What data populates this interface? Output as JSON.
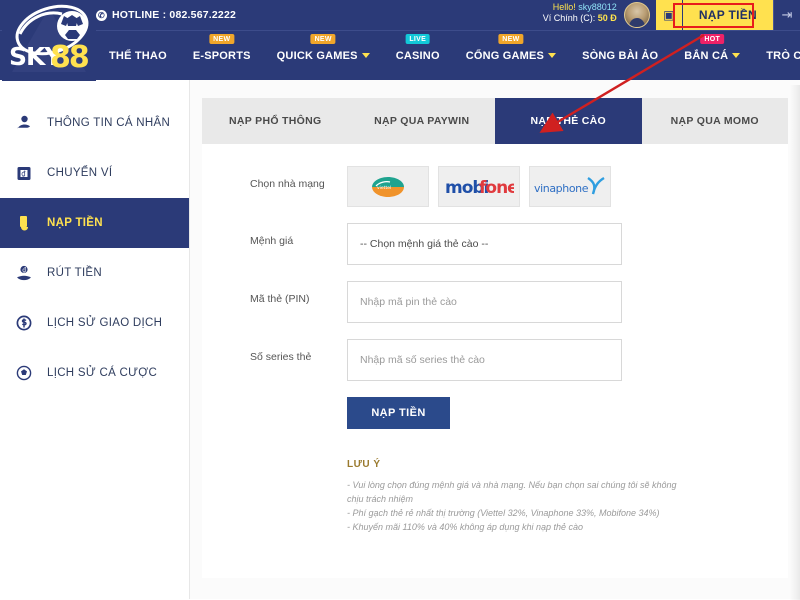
{
  "header": {
    "hotline_icon": "phone-icon",
    "hotline_label": "HOTLINE : 082.567.2222",
    "hello_prefix": "Hello! ",
    "username": "sky88012",
    "wallet_label": "Ví Chính (C): ",
    "wallet_amount": "50 Đ",
    "avatar_name": "avatar",
    "wallet_button_icon": "wallet-icon",
    "deposit_button_label": "NẠP TIỀN",
    "logout_icon": "logout-icon",
    "logo_text_sky": "SKY",
    "logo_text_88": "88",
    "accent_yellow": "#ffe14f",
    "brand_navy": "#2b3a78",
    "highlight_red": "#e81c1c"
  },
  "nav": {
    "items": [
      {
        "label": "THỂ THAO",
        "badge": "",
        "caret": false
      },
      {
        "label": "E-SPORTS",
        "badge": "NEW",
        "badge_type": "new",
        "caret": false
      },
      {
        "label": "QUICK GAMES",
        "badge": "NEW",
        "badge_type": "new",
        "caret": true
      },
      {
        "label": "CASINO",
        "badge": "LIVE",
        "badge_type": "live",
        "caret": false
      },
      {
        "label": "CỔNG GAMES",
        "badge": "NEW",
        "badge_type": "new",
        "caret": true
      },
      {
        "label": "SÒNG BÀI ẢO",
        "badge": "",
        "caret": false
      },
      {
        "label": "BẮN CÁ",
        "badge": "HOT",
        "badge_type": "hot",
        "caret": true
      },
      {
        "label": "TRÒ CHƠI ẢO",
        "badge": "",
        "caret": false
      }
    ]
  },
  "sidebar": {
    "items": [
      {
        "label": "THÔNG TIN CÁ NHÂN",
        "icon": "user-icon",
        "active": false
      },
      {
        "label": "CHUYỂN VÍ",
        "icon": "wallet-transfer-icon",
        "active": false
      },
      {
        "label": "NẠP TIỀN",
        "icon": "deposit-hand-icon",
        "active": true
      },
      {
        "label": "RÚT TIỀN",
        "icon": "withdraw-hand-icon",
        "active": false
      },
      {
        "label": "LỊCH SỬ GIAO DỊCH",
        "icon": "transaction-history-icon",
        "active": false
      },
      {
        "label": "LỊCH SỬ CÁ CƯỢC",
        "icon": "bet-history-icon",
        "active": false
      }
    ]
  },
  "tabs": [
    {
      "label": "NẠP PHỔ THÔNG",
      "active": false
    },
    {
      "label": "NẠP QUA PAYWIN",
      "active": false
    },
    {
      "label": "NẠP THẺ CÀO",
      "active": true
    },
    {
      "label": "NẠP QUA MOMO",
      "active": false
    }
  ],
  "form": {
    "carrier_label": "Chọn nhà mạng",
    "carriers": [
      {
        "name": "viettel",
        "label": "viettel"
      },
      {
        "name": "mobifone",
        "label": "mobifone"
      },
      {
        "name": "vinaphone",
        "label": "vinaphone"
      }
    ],
    "denom_label": "Mệnh giá",
    "denom_value": "-- Chọn mệnh giá thẻ cào --",
    "pin_label": "Mã thẻ (PIN)",
    "pin_placeholder": "Nhập mã pin thẻ cào",
    "serial_label": "Số series thẻ",
    "serial_placeholder": "Nhập mã số series thẻ cào",
    "submit_label": "NẠP TIỀN"
  },
  "note": {
    "title": "LƯU Ý",
    "lines": [
      "- Vui lòng chọn đúng mệnh giá và nhà mạng. Nếu bạn chọn sai chúng tôi sẽ không chịu trách nhiệm",
      "- Phí gạch thẻ rẻ nhất thị trường (Viettel 32%, Vinaphone 33%, Mobifone 34%)",
      "- Khuyến mãi 110% và 40% không áp dụng khi nạp thẻ cào"
    ]
  },
  "annotation": {
    "arrow_name": "red-pointer-arrow",
    "arrow_color": "#d02020"
  }
}
